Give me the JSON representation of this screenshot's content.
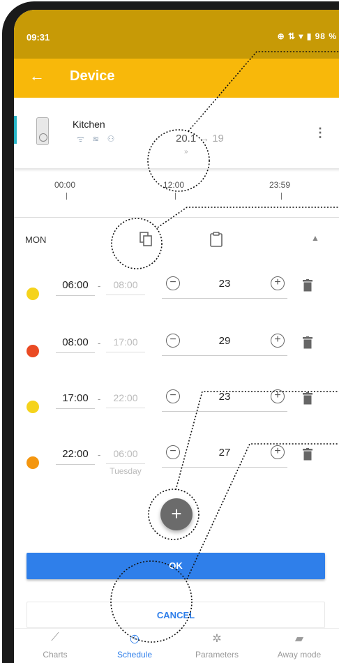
{
  "status_bar": {
    "time": "09:31",
    "icons_text": "⊕ ⇅ ▾ ▮ 98 %"
  },
  "app_bar": {
    "back_icon": "arrow-left-icon",
    "title": "Device"
  },
  "device": {
    "name": "Kitchen",
    "status_icons": "ᯤ ≋ ⚇",
    "current_temp": "20.1",
    "arrow": "→",
    "target_temp": "19",
    "chevron": "»",
    "more_icon": "⋮"
  },
  "timeline": {
    "labels": [
      "00:00",
      "12:00",
      "23:59"
    ]
  },
  "day": {
    "label": "MON",
    "copy_icon": "copy-icon",
    "paste_icon": "clipboard-icon",
    "collapse_icon": "▲"
  },
  "slots": [
    {
      "color": "#f5d31c",
      "start": "06:00",
      "end": "08:00",
      "end_note": "",
      "temp": "23"
    },
    {
      "color": "#ea4a23",
      "start": "08:00",
      "end": "17:00",
      "end_note": "",
      "temp": "29"
    },
    {
      "color": "#f5d31c",
      "start": "17:00",
      "end": "22:00",
      "end_note": "",
      "temp": "23"
    },
    {
      "color": "#f4960f",
      "start": "22:00",
      "end": "06:00",
      "end_note": "Tuesday",
      "temp": "27"
    }
  ],
  "separator": "-",
  "minus_glyph": "−",
  "plus_glyph": "+",
  "add_button": "+",
  "ok_label": "OK",
  "cancel_label": "CANCEL",
  "bottom_nav": [
    {
      "label": "Charts",
      "icon": "chart-icon",
      "glyph": "⟋"
    },
    {
      "label": "Schedule",
      "icon": "clock-icon",
      "glyph": "◷"
    },
    {
      "label": "Parameters",
      "icon": "gear-icon",
      "glyph": "✲"
    },
    {
      "label": "Away mode",
      "icon": "briefcase-icon",
      "glyph": "▰"
    }
  ],
  "colors": {
    "status": "#c79a06",
    "appbar": "#f8b80a",
    "accent": "#2f7fea",
    "device_accent": "#28b6c8"
  }
}
